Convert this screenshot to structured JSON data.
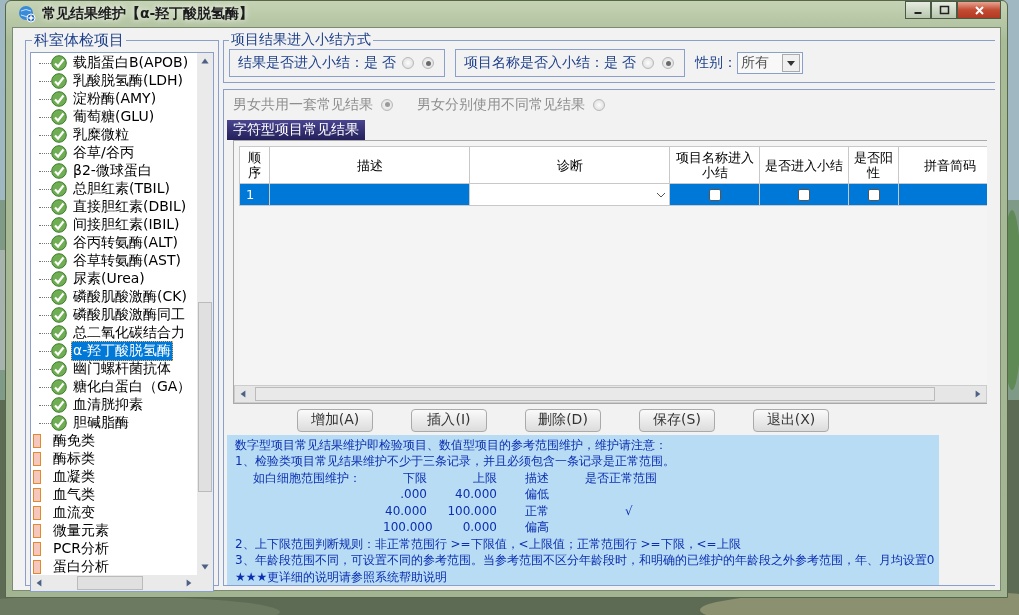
{
  "window": {
    "title": "常见结果维护【α-羟丁酸脱氢酶】"
  },
  "tree_panel": {
    "title": "科室体检项目",
    "items": [
      {
        "label": "载脂蛋白B(APOB)",
        "kind": "test",
        "selected": false
      },
      {
        "label": "乳酸脱氢酶(LDH)",
        "kind": "test",
        "selected": false
      },
      {
        "label": "淀粉酶(AMY)",
        "kind": "test",
        "selected": false
      },
      {
        "label": "葡萄糖(GLU)",
        "kind": "test",
        "selected": false
      },
      {
        "label": "乳糜微粒",
        "kind": "test",
        "selected": false
      },
      {
        "label": "谷草/谷丙",
        "kind": "test",
        "selected": false
      },
      {
        "label": "β2-微球蛋白",
        "kind": "test",
        "selected": false
      },
      {
        "label": "总胆红素(TBIL)",
        "kind": "test",
        "selected": false
      },
      {
        "label": "直接胆红素(DBIL)",
        "kind": "test",
        "selected": false
      },
      {
        "label": "间接胆红素(IBIL)",
        "kind": "test",
        "selected": false
      },
      {
        "label": "谷丙转氨酶(ALT)",
        "kind": "test",
        "selected": false
      },
      {
        "label": "谷草转氨酶(AST)",
        "kind": "test",
        "selected": false
      },
      {
        "label": "尿素(Urea)",
        "kind": "test",
        "selected": false
      },
      {
        "label": "磷酸肌酸激酶(CK)",
        "kind": "test",
        "selected": false
      },
      {
        "label": "磷酸肌酸激酶同工",
        "kind": "test",
        "selected": false
      },
      {
        "label": "总二氧化碳结合力",
        "kind": "test",
        "selected": false
      },
      {
        "label": "α-羟丁酸脱氢酶",
        "kind": "test",
        "selected": true
      },
      {
        "label": "幽门螺杆菌抗体",
        "kind": "test",
        "selected": false
      },
      {
        "label": "糖化白蛋白（GA）",
        "kind": "test",
        "selected": false
      },
      {
        "label": "血清胱抑素",
        "kind": "test",
        "selected": false
      },
      {
        "label": "胆碱脂酶",
        "kind": "test",
        "selected": false
      },
      {
        "label": "酶免类",
        "kind": "category",
        "selected": false
      },
      {
        "label": "酶标类",
        "kind": "category",
        "selected": false
      },
      {
        "label": "血凝类",
        "kind": "category",
        "selected": false
      },
      {
        "label": "血气类",
        "kind": "category",
        "selected": false
      },
      {
        "label": "血流变",
        "kind": "category",
        "selected": false
      },
      {
        "label": "微量元素",
        "kind": "category",
        "selected": false
      },
      {
        "label": "PCR分析",
        "kind": "category",
        "selected": false
      },
      {
        "label": "蛋白分析",
        "kind": "category",
        "selected": false
      }
    ]
  },
  "summary_group": {
    "title": "项目结果进入小结方式",
    "settings": [
      {
        "label": "结果是否进入小结：是",
        "options": [
          {
            "label": "否",
            "selected": false
          },
          {
            "selected": true
          }
        ]
      },
      {
        "label": "项目名称是否入小结：是",
        "options": [
          {
            "label": "否",
            "selected": false
          },
          {
            "selected": true
          }
        ]
      }
    ],
    "gender": {
      "label": "性别：",
      "value": "所有"
    }
  },
  "sex_mode": [
    {
      "label": "男女共用一套常见结果",
      "selected": true
    },
    {
      "label": "男女分别使用不同常见结果",
      "selected": false
    }
  ],
  "tab": {
    "label": "字符型项目常见结果"
  },
  "table": {
    "columns": [
      "顺序",
      "描述",
      "诊断",
      "项目名称进入小结",
      "是否进入小结",
      "是否阳性",
      "拼音简码"
    ],
    "rows": [
      {
        "order": "1",
        "name_in_summary": false,
        "in_summary": false,
        "positive": false,
        "selected": true
      }
    ]
  },
  "buttons": [
    "增加(A)",
    "插入(I)",
    "删除(D)",
    "保存(S)",
    "退出(X)"
  ],
  "notes": {
    "intro": "数字型项目常见结果维护即检验项目、数值型项目的参考范围维护，维护请注意：",
    "rule_1": "1、检验类项目常见结果维护不少于三条记录，并且必须包含一条记录是正常范围。",
    "example": {
      "label": "如白细胞范围维护：",
      "columns": [
        "下限",
        "上限",
        "描述",
        "是否正常范围"
      ],
      "rows": [
        {
          "lower": ".000",
          "upper": "40.000",
          "description": "偏低"
        },
        {
          "lower": "40.000",
          "upper": "100.000",
          "description": "正常",
          "normal": "√"
        },
        {
          "lower": "100.000",
          "upper": "0.000",
          "description": "偏高"
        }
      ]
    },
    "rules": [
      "2、上下限范围判断规则：非正常范围行 >=下限值，<上限值；正常范围行 >=下限，<=上限",
      "3、年龄段范围不同，可设置不同的参考范围。当参考范围不区分年龄段时，和明确的已维护的年龄段之外参考范围，年、月均设置0",
      "★★★更详细的说明请参照系统帮助说明"
    ]
  }
}
